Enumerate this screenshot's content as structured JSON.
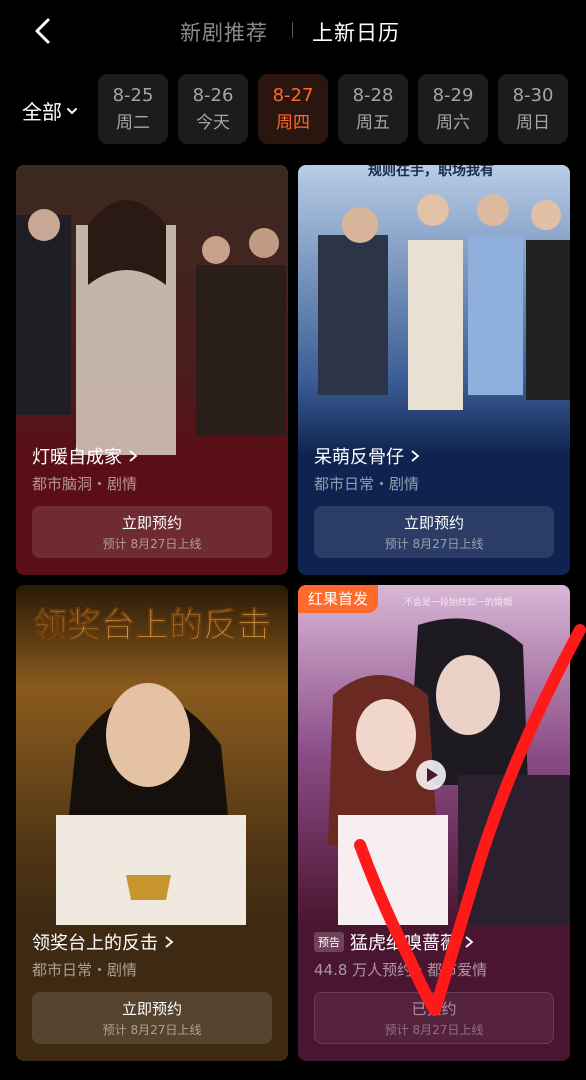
{
  "header": {
    "tab_recommend": "新剧推荐",
    "tab_calendar": "上新日历"
  },
  "filter": {
    "label": "全部"
  },
  "dates": [
    {
      "date": "8-25",
      "weekday": "周二",
      "active": false
    },
    {
      "date": "8-26",
      "weekday": "今天",
      "active": false
    },
    {
      "date": "8-27",
      "weekday": "周四",
      "active": true
    },
    {
      "date": "8-28",
      "weekday": "周五",
      "active": false
    },
    {
      "date": "8-29",
      "weekday": "周六",
      "active": false
    },
    {
      "date": "8-30",
      "weekday": "周日",
      "active": false
    }
  ],
  "cards": [
    {
      "title": "灯暖自成家",
      "sub": "都市脑洞・剧情",
      "btn": "立即预约",
      "btn_sub": "预计 8月27日上线"
    },
    {
      "title": "呆萌反骨仔",
      "sub": "都市日常・剧情",
      "btn": "立即预约",
      "btn_sub": "预计 8月27日上线",
      "poster_caption": "规则在手，职场我有"
    },
    {
      "title": "领奖台上的反击",
      "sub": "都市日常・剧情",
      "btn": "立即预约",
      "btn_sub": "预计 8月27日上线",
      "poster_caption": "领奖台上的反击"
    },
    {
      "title": "猛虎细嗅蔷薇",
      "sub": "44.8 万人预约・都市爱情",
      "btn": "已预约",
      "btn_sub": "预计 8月27日上线",
      "tag": "红果首发",
      "preview_tag": "预告",
      "poster_caption": "不会是一段始终如一的婚姻"
    }
  ],
  "colors": {
    "accent": "#ff6a2c",
    "check": "#ff1a1a"
  }
}
